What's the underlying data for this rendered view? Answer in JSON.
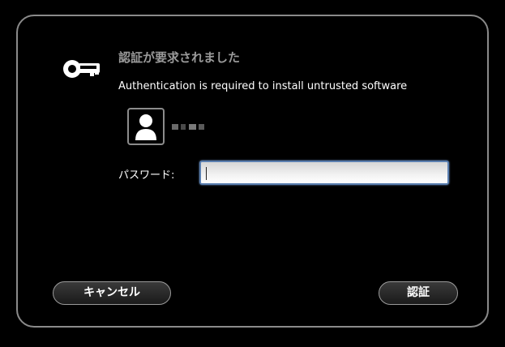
{
  "dialog": {
    "title": "認証が要求されました",
    "message": "Authentication is required to install untrusted software",
    "icon": "key-icon",
    "user": {
      "avatar_icon": "user-avatar-icon",
      "name": ""
    },
    "password": {
      "label": "パスワード:",
      "value": "",
      "placeholder": ""
    },
    "buttons": {
      "cancel": "キャンセル",
      "authenticate": "認証"
    },
    "colors": {
      "background": "#000000",
      "border": "#8a8a8a",
      "title": "#9a9a9a",
      "input_focus": "#5a7fb0"
    }
  }
}
